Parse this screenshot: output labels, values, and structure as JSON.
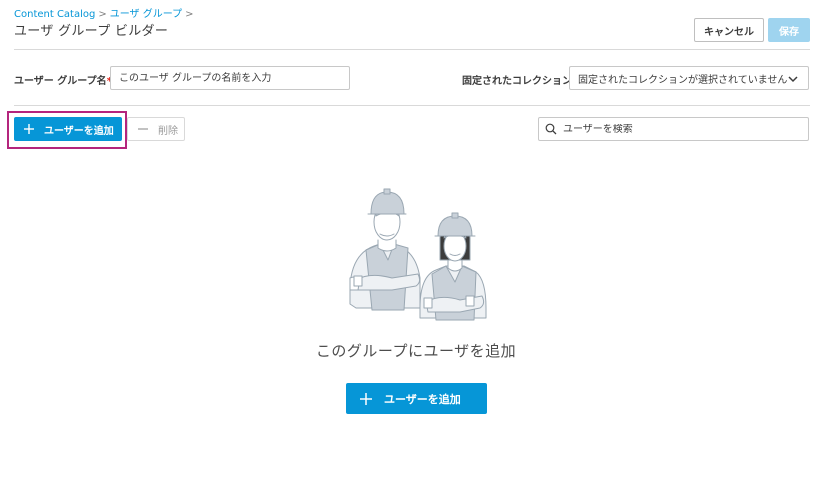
{
  "breadcrumb": {
    "items": [
      "Content Catalog",
      "ユーザ グループ"
    ],
    "separator": ">"
  },
  "page_title": "ユーザ グループ ビルダー",
  "header": {
    "cancel_label": "キャンセル",
    "save_label": "保存"
  },
  "form": {
    "group_name_label": "ユーザー グループ名",
    "required_mark": "*",
    "group_name_placeholder": "このユーザ グループの名前を入力",
    "collection_label": "固定されたコレクション",
    "collection_value": "固定されたコレクションが選択されていません"
  },
  "toolbar": {
    "add_user_label": "ユーザーを追加",
    "delete_label": "削除",
    "search_placeholder": "ユーザーを検索"
  },
  "empty_state": {
    "message": "このグループにユーザを追加",
    "add_user_label": "ユーザーを追加"
  },
  "colors": {
    "accent": "#0696d7",
    "save_disabled": "#9fd4ef",
    "highlight": "#b4257d",
    "required": "#e2231a"
  },
  "icons": {
    "add": "plus-icon",
    "delete": "minus-icon",
    "search": "search-icon",
    "dropdown": "chevron-down-icon"
  }
}
